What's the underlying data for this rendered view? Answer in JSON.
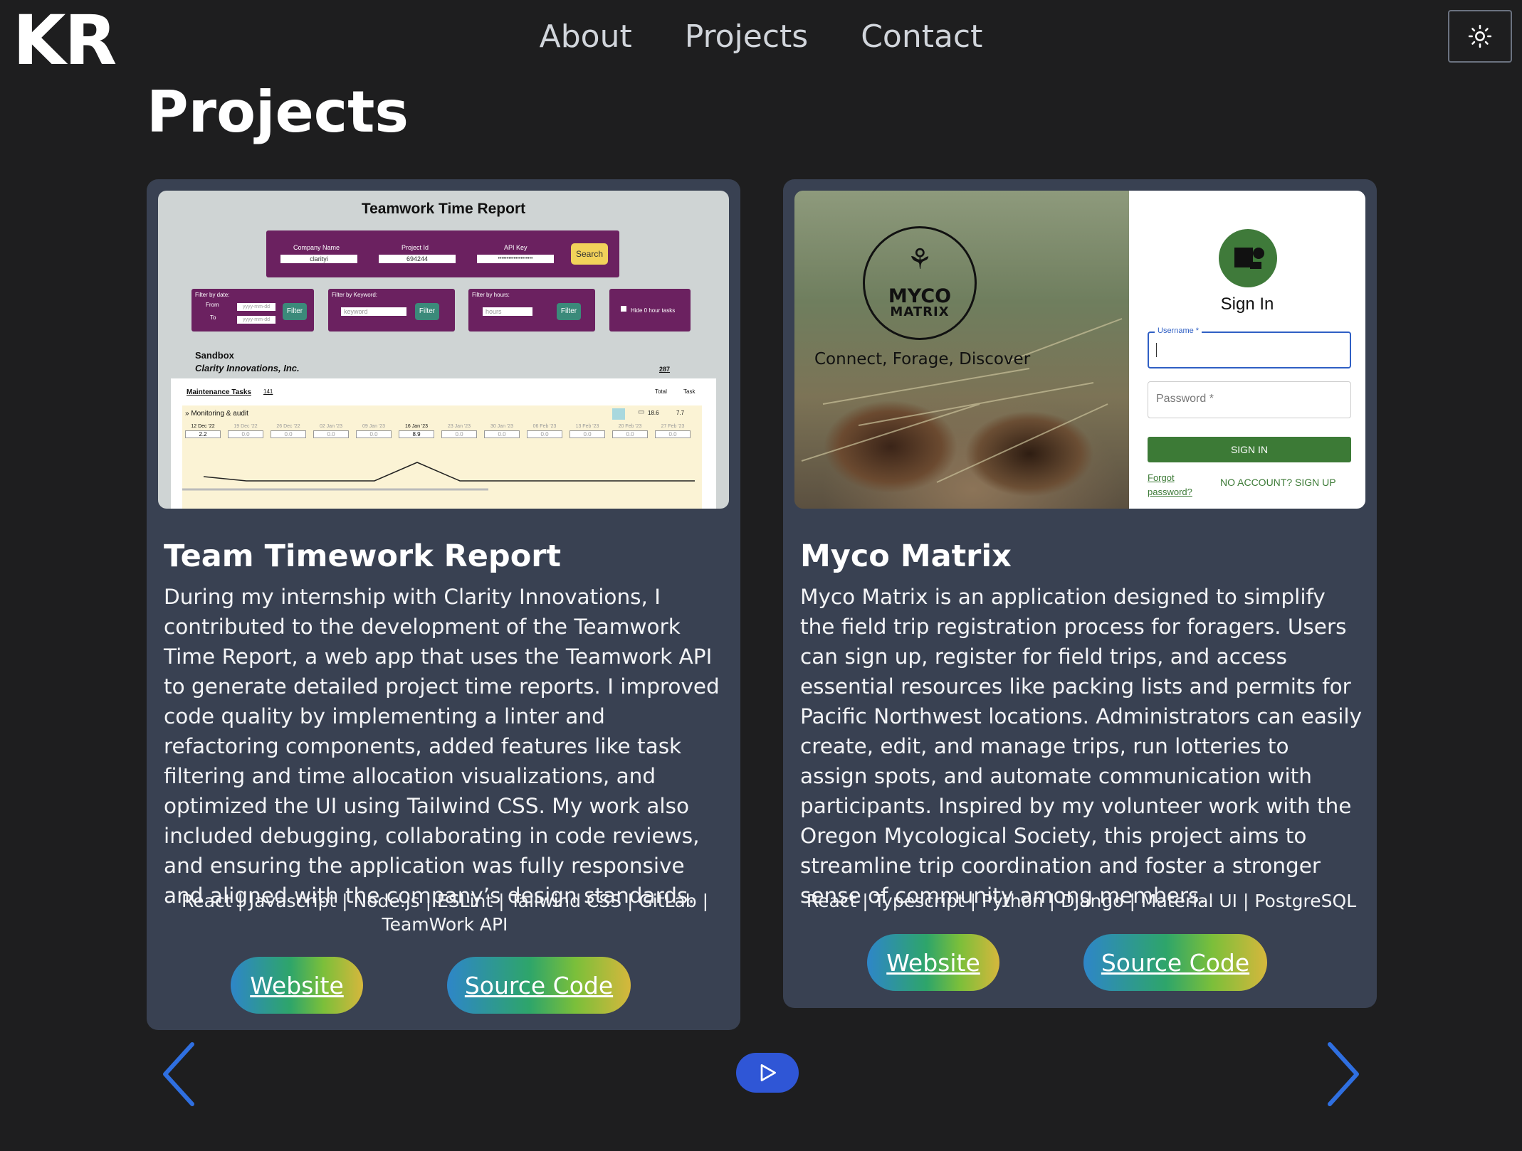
{
  "header": {
    "logo": "KR",
    "nav": [
      "About",
      "Projects",
      "Contact"
    ],
    "theme_icon": "sun-icon"
  },
  "page": {
    "title": "Projects"
  },
  "projects": [
    {
      "title": "Team Timework Report",
      "description": "During my internship with Clarity Innovations, I contributed to the development of the Teamwork Time Report, a web app that uses the Teamwork API to generate detailed project time reports. I improved code quality by implementing a linter and refactoring components, added features like task filtering and time allocation visualizations, and optimized the UI using Tailwind CSS. My work also included debugging, collaborating in code reviews, and ensuring the application was fully responsive and aligned with the company’s design standards.",
      "tech": "React | Javascript | Node.js | ESLint | Tailwind CSS | GitLab | TeamWork API",
      "website_label": "Website",
      "source_label": "Source Code",
      "screenshot": {
        "title": "Teamwork Time Report",
        "company_label": "Company Name",
        "company_value": "clarityi",
        "project_label": "Project Id",
        "project_value": "694244",
        "api_label": "API Key",
        "api_value": "••••••••••••••••••••",
        "search_label": "Search",
        "filter_date_label": "Filter by date:",
        "from_label": "From",
        "to_label": "To",
        "date_placeholder": "yyyy-mm-dd",
        "filter_keyword_label": "Filter by Keyword:",
        "keyword_placeholder": "keyword",
        "filter_hours_label": "Filter by hours:",
        "hours_placeholder": "hours",
        "filter_button": "Filter",
        "hide_label": "Hide 0 hour tasks",
        "sandbox": "Sandbox",
        "company_full": "Clarity Innovations, Inc.",
        "company_total": "287",
        "tasks_label": "Maintenance Tasks",
        "tasks_count": "141",
        "col_total": "Total",
        "col_task": "Task",
        "task_name": "» Monitoring & audit",
        "task_total": "18.6",
        "task_task": "7.7",
        "dates": [
          "12 Dec '22",
          "19 Dec '22",
          "26 Dec '22",
          "02 Jan '23",
          "09 Jan '23",
          "16 Jan '23",
          "23 Jan '23",
          "30 Jan '23",
          "06 Feb '23",
          "13 Feb '23",
          "20 Feb '23",
          "27 Feb '23"
        ],
        "hours": [
          "2.2",
          "0.0",
          "0.0",
          "0.0",
          "0.0",
          "8.9",
          "0.0",
          "0.0",
          "0.0",
          "0.0",
          "0.0",
          "0.0"
        ]
      }
    },
    {
      "title": "Myco Matrix",
      "description": "Myco Matrix is an application designed to simplify the field trip registration process for foragers. Users can sign up, register for field trips, and access essential resources like packing lists and permits for Pacific Northwest locations. Administrators can easily create, edit, and manage trips, run lotteries to assign spots, and automate communication with participants. Inspired by my volunteer work with the Oregon Mycological Society, this project aims to streamline trip coordination and foster a stronger sense of community among members.",
      "tech": "React | Typescript | Python | Django | Material UI | PostgreSQL",
      "website_label": "Website",
      "source_label": "Source Code",
      "screenshot": {
        "logo_line1": "MYCO",
        "logo_line2": "MATRIX",
        "tagline": "Connect, Forage, Discover",
        "signin_title": "Sign In",
        "username_label": "Username *",
        "password_label": "Password *",
        "signin_button": "SIGN IN",
        "forgot_label": "Forgot password?",
        "signup_label": "NO ACCOUNT? SIGN UP"
      }
    }
  ],
  "carousel": {
    "prev_icon": "chevron-left-icon",
    "next_icon": "chevron-right-icon",
    "play_icon": "play-icon"
  }
}
